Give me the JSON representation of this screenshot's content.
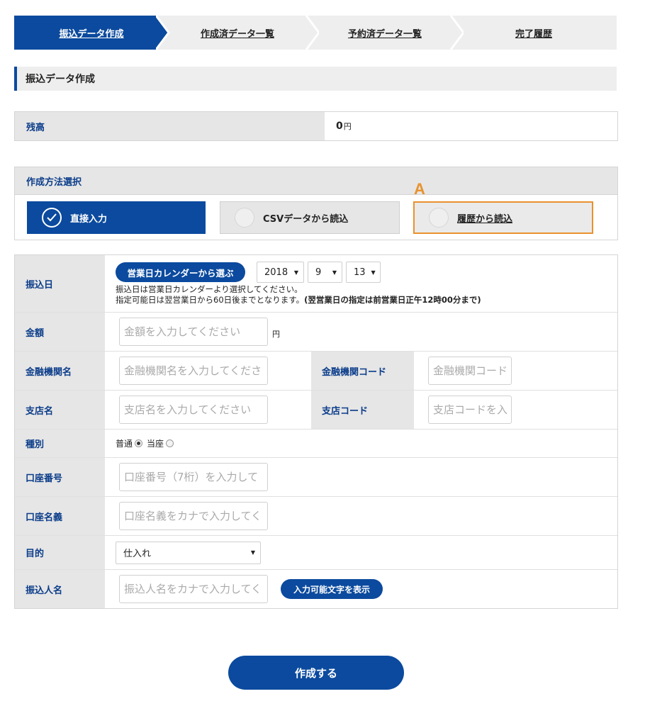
{
  "steps": [
    {
      "label": "振込データ作成"
    },
    {
      "label": "作成済データ一覧"
    },
    {
      "label": "予約済データ一覧"
    },
    {
      "label": "完了履歴"
    }
  ],
  "section_title": "振込データ作成",
  "balance": {
    "label": "残高",
    "value": "0",
    "unit": "円"
  },
  "method": {
    "title": "作成方法選択",
    "options": [
      {
        "label": "直接入力",
        "selected": true
      },
      {
        "label": "CSVデータから読込",
        "selected": false
      },
      {
        "label": "履歴から読込",
        "selected": false
      }
    ],
    "marker": "A"
  },
  "form": {
    "date": {
      "label": "振込日",
      "calendar_button": "営業日カレンダーから選ぶ",
      "year": "2018",
      "month": "9",
      "day": "13",
      "note1": "振込日は営業日カレンダーより選択してください。",
      "note2_a": "指定可能日は翌営業日から60日後までとなります。",
      "note2_b": "(翌営業日の指定は前営業日正午12時00分まで)"
    },
    "amount": {
      "label": "金額",
      "placeholder": "金額を入力してください",
      "unit": "円"
    },
    "bank_name": {
      "label": "金融機関名",
      "placeholder": "金融機関名を入力してくださ"
    },
    "bank_code": {
      "label": "金融機関コード",
      "placeholder": "金融機関コード"
    },
    "branch_name": {
      "label": "支店名",
      "placeholder": "支店名を入力してください"
    },
    "branch_code": {
      "label": "支店コード",
      "placeholder": "支店コードを入"
    },
    "type": {
      "label": "種別",
      "option1": "普通",
      "option2": "当座",
      "selected": "普通"
    },
    "account_no": {
      "label": "口座番号",
      "placeholder": "口座番号（7桁）を入力して"
    },
    "account_name": {
      "label": "口座名義",
      "placeholder": "口座名義をカナで入力してく"
    },
    "purpose": {
      "label": "目的",
      "value": "仕入れ"
    },
    "sender": {
      "label": "振込人名",
      "placeholder": "振込人名をカナで入力してく",
      "button": "入力可能文字を表示"
    }
  },
  "submit_label": "作成する",
  "colors": {
    "primary": "#0b4a9e",
    "highlight": "#e8922e",
    "label_bg": "#e6e6e6"
  }
}
